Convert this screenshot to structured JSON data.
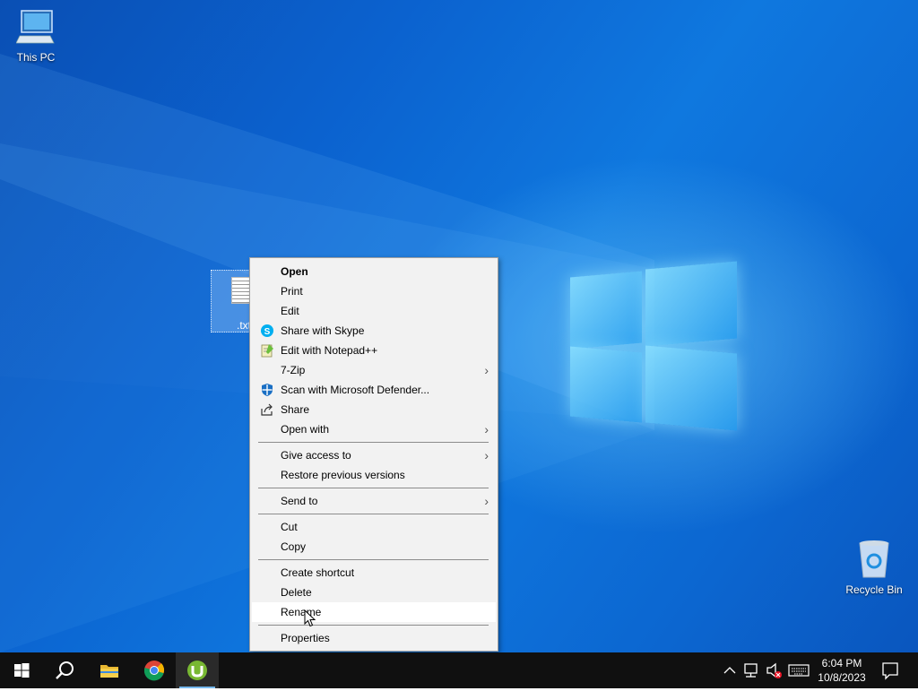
{
  "desktop": {
    "icons": {
      "this_pc": "This PC",
      "recycle_bin": "Recycle Bin",
      "file": ".txt"
    }
  },
  "context_menu": {
    "open": "Open",
    "print": "Print",
    "edit": "Edit",
    "share_skype": "Share with Skype",
    "edit_notepad": "Edit with Notepad++",
    "seven_zip": "7-Zip",
    "scan_defender": "Scan with Microsoft Defender...",
    "share": "Share",
    "open_with": "Open with",
    "give_access": "Give access to",
    "restore_versions": "Restore previous versions",
    "send_to": "Send to",
    "cut": "Cut",
    "copy": "Copy",
    "create_shortcut": "Create shortcut",
    "delete": "Delete",
    "rename": "Rename",
    "properties": "Properties"
  },
  "taskbar": {
    "time": "6:04 PM",
    "date": "10/8/2023"
  },
  "colors": {
    "desktop_blue": "#0b62cf",
    "taskbar": "#101010",
    "menu_bg": "#f2f2f2",
    "accent": "#76b9ed"
  }
}
